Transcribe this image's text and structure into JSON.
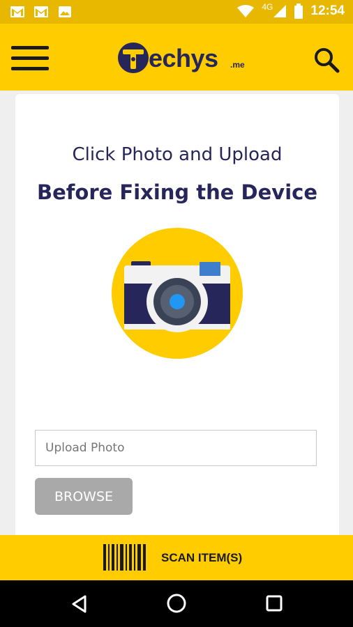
{
  "status_bar": {
    "time": "12:54",
    "network": "4G",
    "icons": [
      "gmail-icon",
      "gmail-icon",
      "image-icon",
      "wifi-icon",
      "signal-icon",
      "battery-icon"
    ]
  },
  "app_bar": {
    "logo_text": "echys",
    "logo_suffix": ".me",
    "menu_icon": "hamburger-menu-icon",
    "search_icon": "search-icon"
  },
  "main": {
    "line1": "Click Photo and Upload",
    "line2": "Before Fixing the Device",
    "illustration": "camera-icon",
    "upload_field": {
      "placeholder": "Upload Photo",
      "value": ""
    },
    "browse_label": "BROWSE"
  },
  "scan_bar": {
    "label": "SCAN ITEM(S)",
    "icon": "barcode-icon"
  },
  "nav": {
    "back": "back-icon",
    "home": "home-icon",
    "recent": "recent-apps-icon"
  },
  "colors": {
    "brand_yellow": "#ffcc00",
    "status_yellow": "#e8b800",
    "navy": "#27265a",
    "button_gray": "#a9a9a9",
    "camera_blue": "#2196f3"
  }
}
